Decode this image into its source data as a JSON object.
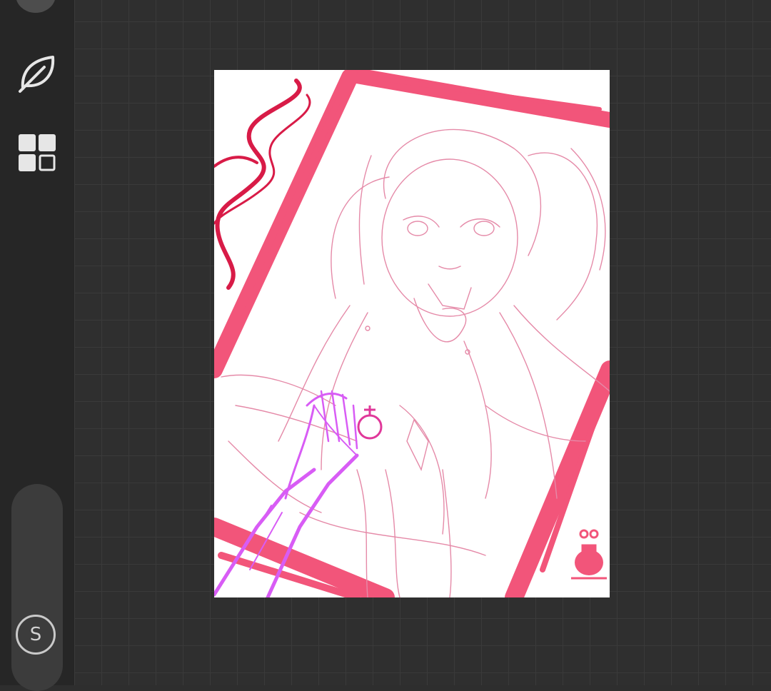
{
  "app": {
    "sidebar": {
      "tools": [
        {
          "name": "leaf-tool",
          "icon": "leaf-icon"
        },
        {
          "name": "layers-tool",
          "icon": "grid-layout-icon"
        }
      ],
      "brush_slider": {
        "thumb_label": "S",
        "level": 0.2
      }
    },
    "canvas": {
      "content": "sketch-artwork",
      "colors": {
        "frame": "#f2557a",
        "ribbon": "#d81b47",
        "sketch": "#e58aa8",
        "hand": "#d85cf5",
        "background": "#ffffff"
      }
    },
    "theme": {
      "sidebar_bg": "#262626",
      "workspace_bg": "#2f2f2f",
      "grid_line": "#3a3a3a",
      "icon": "#e6e6e6"
    }
  }
}
